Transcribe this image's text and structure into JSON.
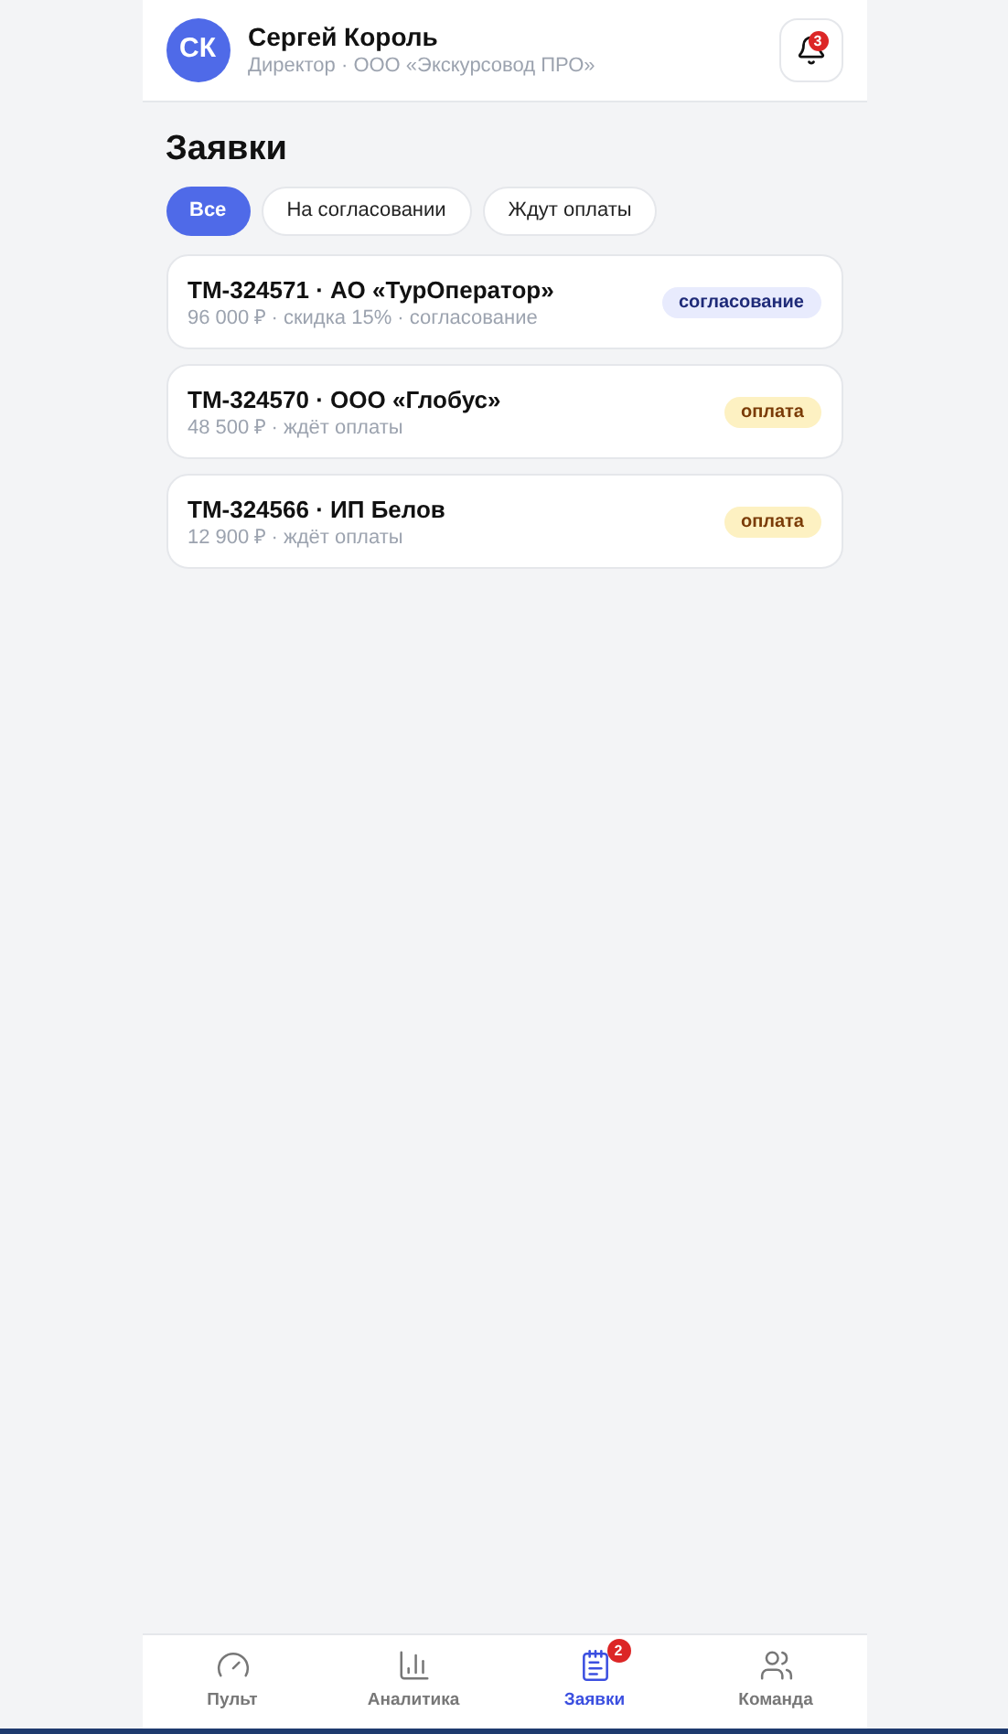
{
  "header": {
    "avatar": "СК",
    "name": "Сергей Король",
    "subtitle": "Директор · ООО «Экскурсовод ПРО»",
    "notifications": "3"
  },
  "title": "Заявки",
  "filters": [
    {
      "label": "Все",
      "selected": true
    },
    {
      "label": "На согласовании",
      "selected": false
    },
    {
      "label": "Ждут оплаты",
      "selected": false
    }
  ],
  "orders": [
    {
      "title": "ТМ-324571 · АО «ТурОператор»",
      "details": "96 000 ₽ · скидка 15% · согласование",
      "status": "согласование",
      "kind": "approval"
    },
    {
      "title": "ТМ-324570 · ООО «Глобус»",
      "details": "48 500 ₽ · ждёт оплаты",
      "status": "оплата",
      "kind": "payment"
    },
    {
      "title": "ТМ-324566 · ИП Белов",
      "details": "12 900 ₽ · ждёт оплаты",
      "status": "оплата",
      "kind": "payment"
    }
  ],
  "nav": [
    {
      "label": "Пульт",
      "selected": false
    },
    {
      "label": "Аналитика",
      "selected": false
    },
    {
      "label": "Заявки",
      "selected": true,
      "badge": "2"
    },
    {
      "label": "Команда",
      "selected": false
    }
  ]
}
